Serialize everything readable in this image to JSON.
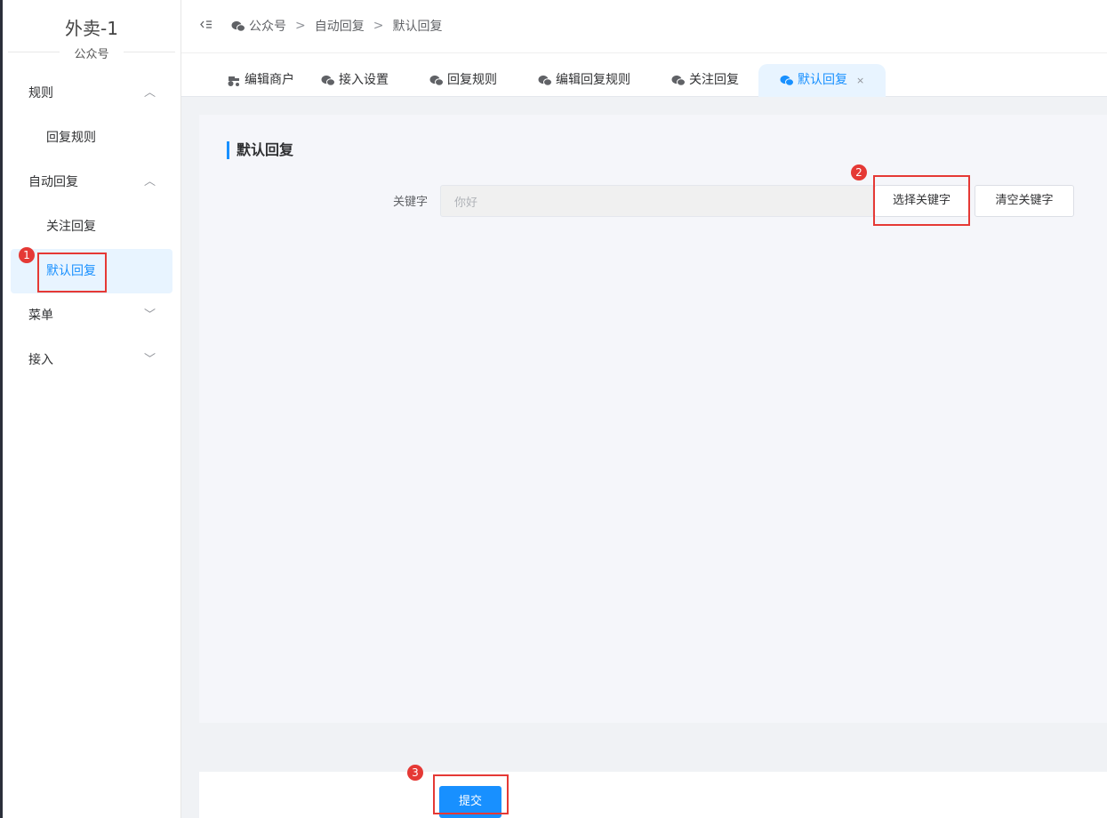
{
  "sidebar": {
    "brand_title": "外卖-1",
    "brand_subtitle": "公众号",
    "groups": [
      {
        "label": "规则",
        "chevron": "up"
      },
      {
        "label": "自动回复",
        "chevron": "up"
      },
      {
        "label": "菜单",
        "chevron": "down"
      },
      {
        "label": "接入",
        "chevron": "down"
      }
    ],
    "items": [
      {
        "label": "回复规则",
        "active": false
      },
      {
        "label": "关注回复",
        "active": false
      },
      {
        "label": "默认回复",
        "active": true
      }
    ]
  },
  "header": {
    "breadcrumb": [
      "公众号",
      "自动回复",
      "默认回复"
    ],
    "separator": ">"
  },
  "tabs": [
    {
      "label": "编辑商户",
      "icon": "tractor-icon"
    },
    {
      "label": "接入设置",
      "icon": "wechat-icon"
    },
    {
      "label": "回复规则",
      "icon": "wechat-icon"
    },
    {
      "label": "编辑回复规则",
      "icon": "wechat-icon"
    },
    {
      "label": "关注回复",
      "icon": "wechat-icon"
    },
    {
      "label": "默认回复",
      "icon": "wechat-icon",
      "active": true,
      "close": "×"
    }
  ],
  "main": {
    "title": "默认回复",
    "keyword_label": "关键字",
    "keyword_value": "你好",
    "select_keyword_label": "选择关键字",
    "clear_keyword_label": "清空关键字",
    "submit_label": "提交"
  },
  "annotations": [
    "1",
    "2",
    "3"
  ],
  "colors": {
    "accent": "#1890ff",
    "active_bg": "#e8f4ff",
    "annotation_red": "#e53935"
  }
}
